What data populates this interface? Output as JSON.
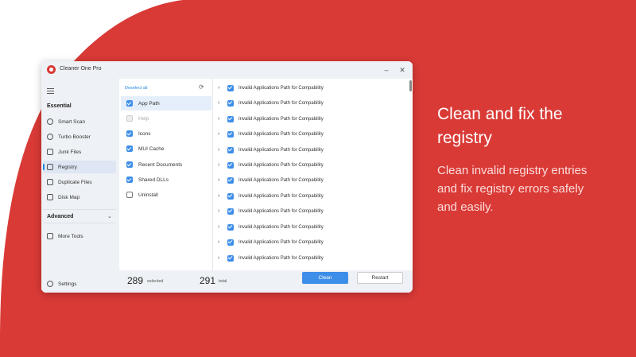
{
  "window": {
    "title": "Cleaner One Pro",
    "minimize": "–",
    "close": "✕"
  },
  "sidebar": {
    "essential_label": "Essential",
    "advanced_label": "Advanced",
    "items": [
      {
        "label": "Smart Scan",
        "icon": "smart-scan-icon"
      },
      {
        "label": "Turbo Booster",
        "icon": "turbo-booster-icon"
      },
      {
        "label": "Junk Files",
        "icon": "junk-files-icon"
      },
      {
        "label": "Registry",
        "icon": "registry-icon",
        "active": true
      },
      {
        "label": "Duplicate Files",
        "icon": "duplicate-files-icon"
      },
      {
        "label": "Disk Map",
        "icon": "disk-map-icon"
      }
    ],
    "more_tools": "More Tools",
    "settings": "Settings"
  },
  "categories": {
    "deselect_all": "Deselect all",
    "items": [
      {
        "label": "App Path",
        "state": "checked",
        "active": true
      },
      {
        "label": "Help",
        "state": "disabled"
      },
      {
        "label": "Icons",
        "state": "checked"
      },
      {
        "label": "MUI Cache",
        "state": "checked"
      },
      {
        "label": "Recent Documents",
        "state": "checked"
      },
      {
        "label": "Shared DLLs",
        "state": "checked"
      },
      {
        "label": "Uninstall",
        "state": "unchecked"
      }
    ]
  },
  "results": {
    "rows": [
      "Invalid Applications Path for Compability",
      "Invalid Applications Path for Compability",
      "Invalid Applications Path for Compability",
      "Invalid Applications Path for Compability",
      "Invalid Applications Path for Compability",
      "Invalid Applications Path for Compability",
      "Invalid Applications Path for Compability",
      "Invalid Applications Path for Compability",
      "Invalid Applications Path for Compability",
      "Invalid Applications Path for Compability",
      "Invalid Applications Path for Compability",
      "Invalid Applications Path for Compability"
    ]
  },
  "footer": {
    "selected_count": "289",
    "selected_label": "selected",
    "total_count": "291",
    "total_label": "total",
    "clean_label": "Clean",
    "restart_label": "Restart"
  },
  "promo": {
    "headline": "Clean and fix the registry",
    "subtext": "Clean invalid registry entries and fix registry errors safely and easily."
  },
  "colors": {
    "brand_red": "#d93a36",
    "accent_blue": "#3d8ee8"
  }
}
